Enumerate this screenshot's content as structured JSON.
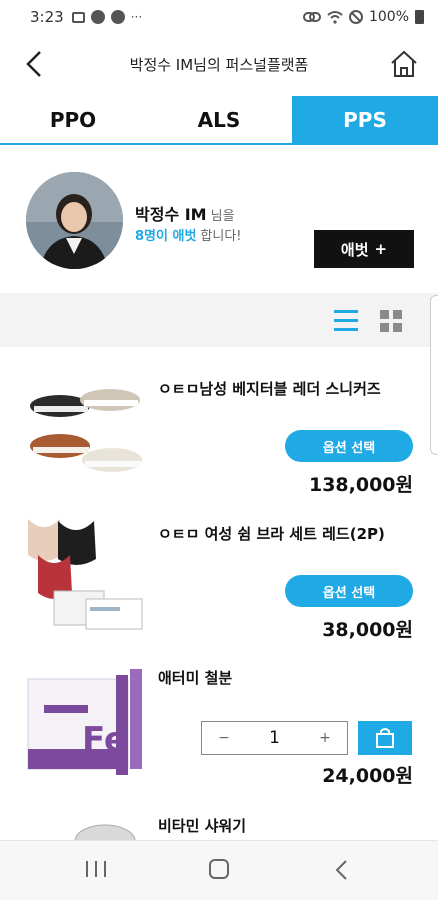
{
  "status_bar": {
    "time": "3:23",
    "battery": "100%",
    "icons": [
      "image-icon",
      "facebook-icon",
      "facebook-icon",
      "more-icon",
      "link-icon",
      "wifi-icon",
      "do-not-disturb-icon",
      "battery-icon"
    ],
    "more": "···"
  },
  "header": {
    "title": "박정수 IM님의 퍼스널플랫폼",
    "back_icon": "chevron-left-icon",
    "home_icon": "home-icon"
  },
  "tabs": [
    {
      "label": "PPO",
      "active": false
    },
    {
      "label": "ALS",
      "active": false
    },
    {
      "label": "PPS",
      "active": true
    }
  ],
  "profile": {
    "name": "박정수 IM",
    "name_suffix": "님을",
    "follower_count": "8명이 애벗",
    "follower_text": "합니다!",
    "follow_button": "애벗",
    "follow_plus": "+"
  },
  "view_toggle": {
    "active": "list",
    "icons": [
      "list-view-icon",
      "grid-view-icon"
    ]
  },
  "products": [
    {
      "title": "ㅇㅌㅁ남성 베지터블 레더 스니커즈",
      "button": "옵션 선택",
      "price": "138,000원"
    },
    {
      "title": "ㅇㅌㅁ 여성 쉼 브라 세트 레드(2P)",
      "button": "옵션 선택",
      "price": "38,000원"
    },
    {
      "title": "애터미 철분",
      "quantity": "1",
      "minus": "−",
      "plus": "+",
      "price": "24,000원"
    },
    {
      "title": "비타민 샤워기"
    }
  ],
  "colors": {
    "accent": "#1fa9e5",
    "dark_button": "#111111",
    "view_bar_bg": "#f3f3f3"
  },
  "nav_bar": {
    "icons": [
      "recent-apps-icon",
      "home-circle-icon",
      "back-icon"
    ]
  }
}
